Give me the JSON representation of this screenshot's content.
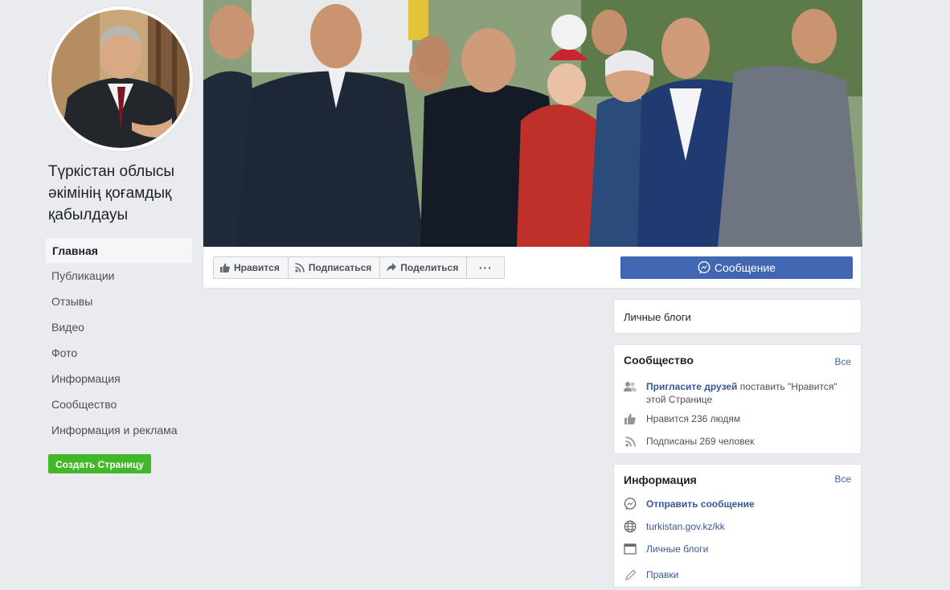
{
  "page": {
    "name": "Түркістан облысы әкімінің қоғамдық қабылдауы"
  },
  "nav": {
    "items": [
      {
        "label": "Главная",
        "active": true
      },
      {
        "label": "Публикации"
      },
      {
        "label": "Отзывы"
      },
      {
        "label": "Видео"
      },
      {
        "label": "Фото"
      },
      {
        "label": "Информация"
      },
      {
        "label": "Сообщество"
      },
      {
        "label": "Информация и реклама"
      }
    ],
    "create_page": "Создать Страницу"
  },
  "actions": {
    "like": "Нравится",
    "follow": "Подписаться",
    "share": "Поделиться",
    "more": "···",
    "message": "Сообщение"
  },
  "category_card": {
    "label": "Личные блоги"
  },
  "community": {
    "title": "Сообщество",
    "see_all": "Все",
    "invite_link": "Пригласите друзей",
    "invite_rest_1": " поставить \"Нравится\"",
    "invite_rest_2": "этой Странице",
    "likes": "Нравится 236 людям",
    "followers": "Подписаны 269 человек"
  },
  "info": {
    "title": "Информация",
    "see_all": "Все",
    "send_message": "Отправить сообщение",
    "website": "turkistan.gov.kz/kk",
    "category": "Личные блоги",
    "edits": "Правки"
  },
  "colors": {
    "brand_blue": "#4267b2",
    "link_blue": "#385898",
    "create_green": "#42b72a",
    "background": "#e9ebee"
  }
}
